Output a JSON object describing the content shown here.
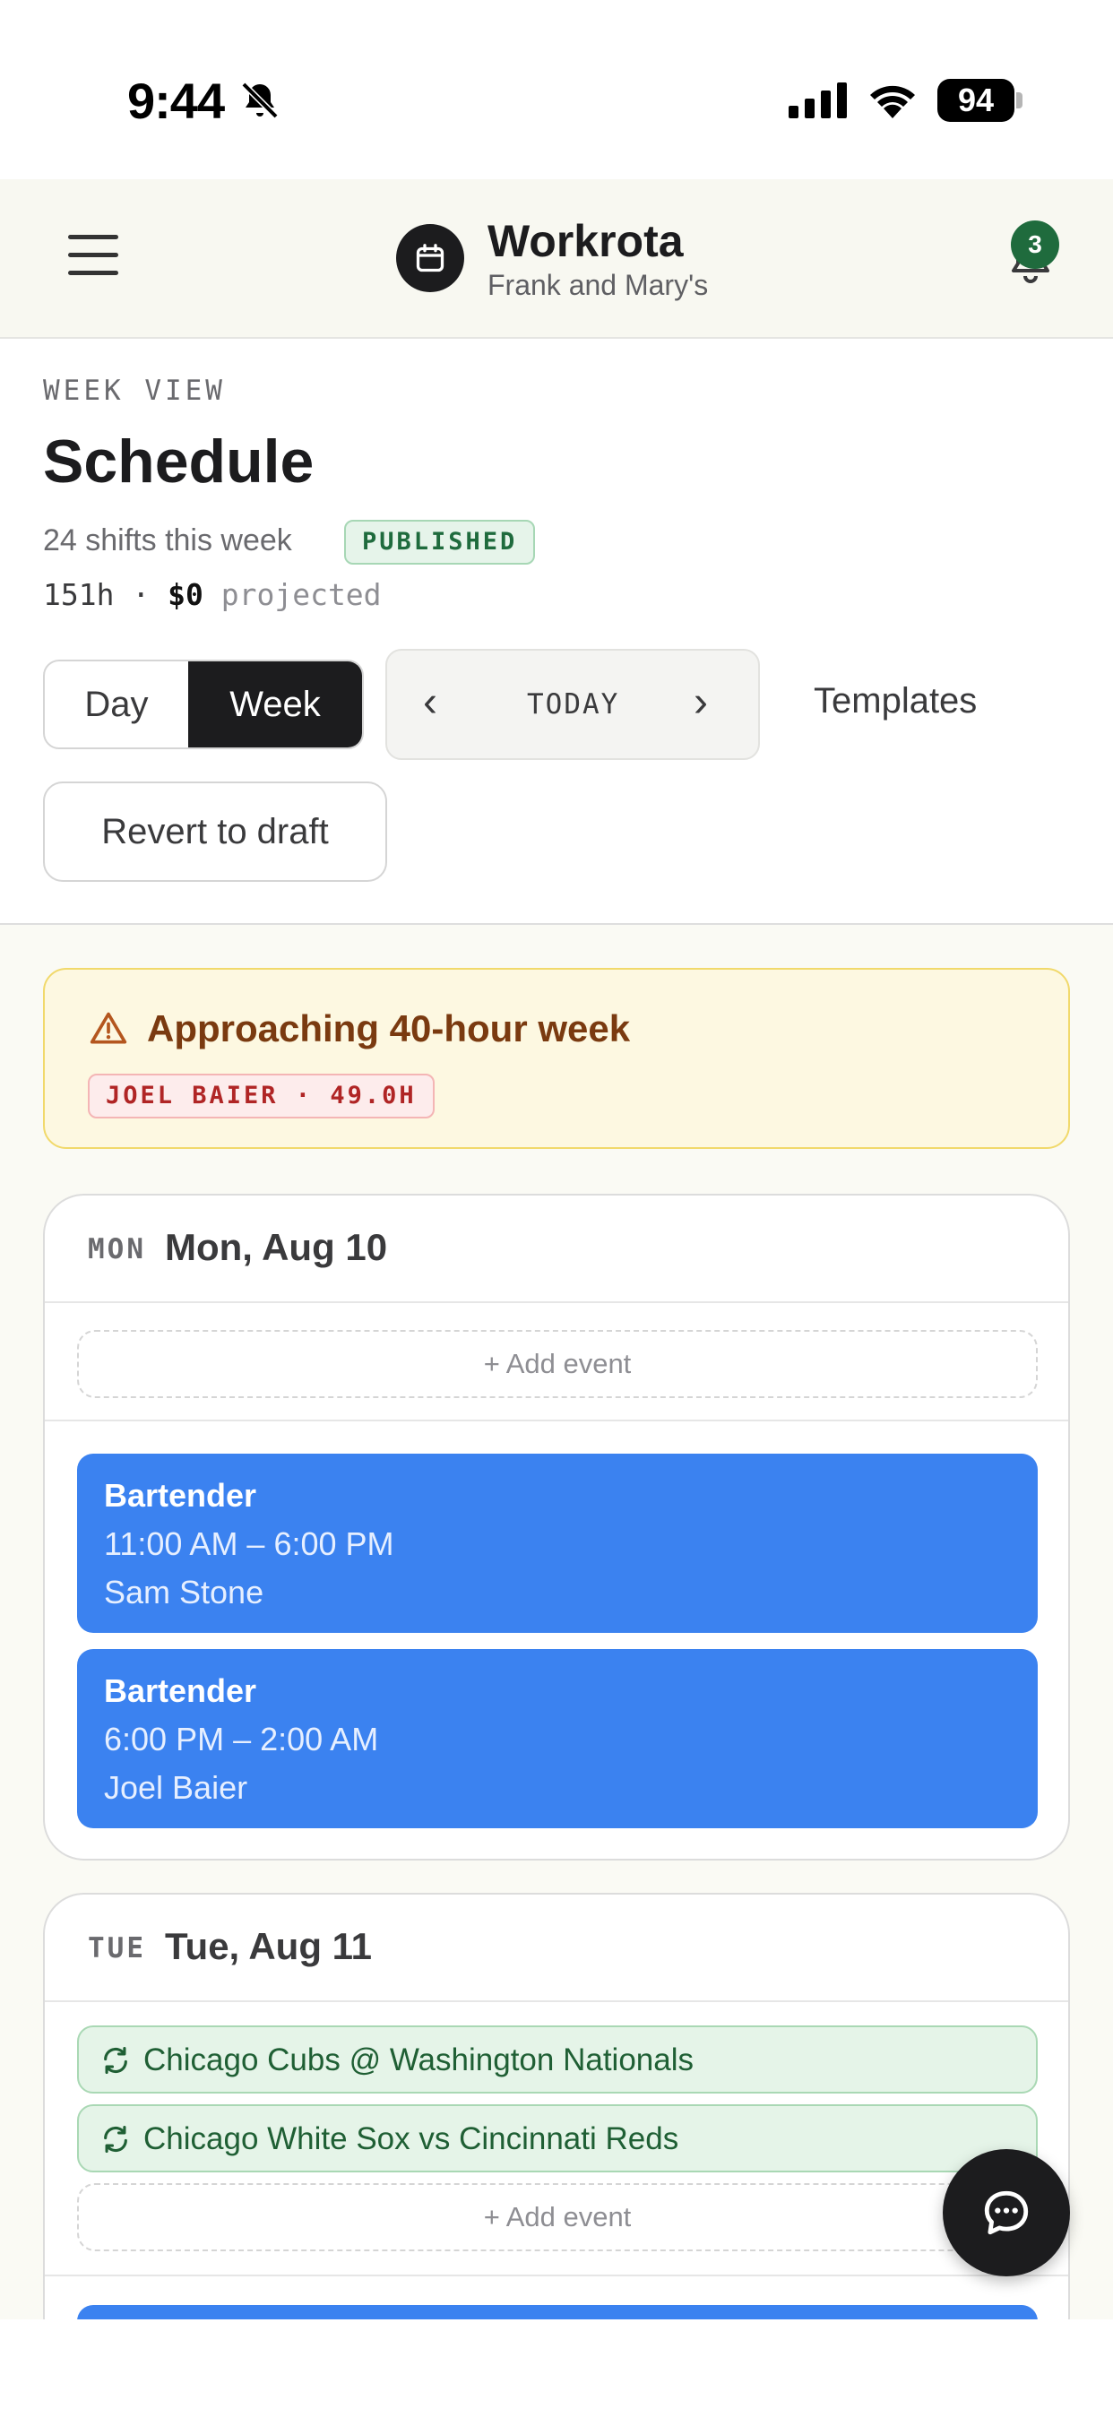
{
  "status_bar": {
    "time": "9:44",
    "battery": "94",
    "icons": [
      "bell-slash-icon",
      "cellular-signal-icon",
      "wifi-icon",
      "battery-icon"
    ]
  },
  "header": {
    "title": "Workrota",
    "subtitle": "Frank and Mary's",
    "notification_count": "3",
    "icons": [
      "menu-icon",
      "calendar-icon",
      "bell-icon"
    ]
  },
  "page": {
    "eyebrow": "WEEK VIEW",
    "title": "Schedule",
    "shift_count": "24 shifts this week",
    "status_badge": "PUBLISHED",
    "hours": "151h",
    "separator": "·",
    "cost": "$0",
    "cost_suffix": "projected"
  },
  "controls": {
    "view_options": [
      "Day",
      "Week"
    ],
    "selected_view": "Week",
    "prev": "‹",
    "today": "TODAY",
    "next": "›",
    "templates": "Templates",
    "revert": "Revert to draft"
  },
  "alert": {
    "title": "Approaching 40-hour week",
    "chip": "JOEL BAIER · 49.0H",
    "icon": "warning-icon"
  },
  "days": [
    {
      "abbr": "MON",
      "date": "Mon, Aug 10",
      "add_event": "+ Add event",
      "events": [],
      "shifts": [
        {
          "role": "Bartender",
          "time": "11:00 AM – 6:00 PM",
          "person": "Sam Stone"
        },
        {
          "role": "Bartender",
          "time": "6:00 PM – 2:00 AM",
          "person": "Joel Baier"
        }
      ]
    },
    {
      "abbr": "TUE",
      "date": "Tue, Aug 11",
      "add_event": "+ Add event",
      "events": [
        {
          "label": "Chicago Cubs @ Washington Nationals",
          "icon": "repeat-icon"
        },
        {
          "label": "Chicago White Sox vs Cincinnati Reds",
          "icon": "repeat-icon"
        }
      ],
      "shifts": []
    }
  ],
  "colors": {
    "accent": "#1c1c1e",
    "shift_blue": "#3b82f0",
    "published_green": "#1f6b3d",
    "warning_text": "#7a3a10",
    "warning_bg": "#fdf8e1",
    "chip_red": "#b02525"
  },
  "fab": {
    "icon": "chat-icon"
  }
}
